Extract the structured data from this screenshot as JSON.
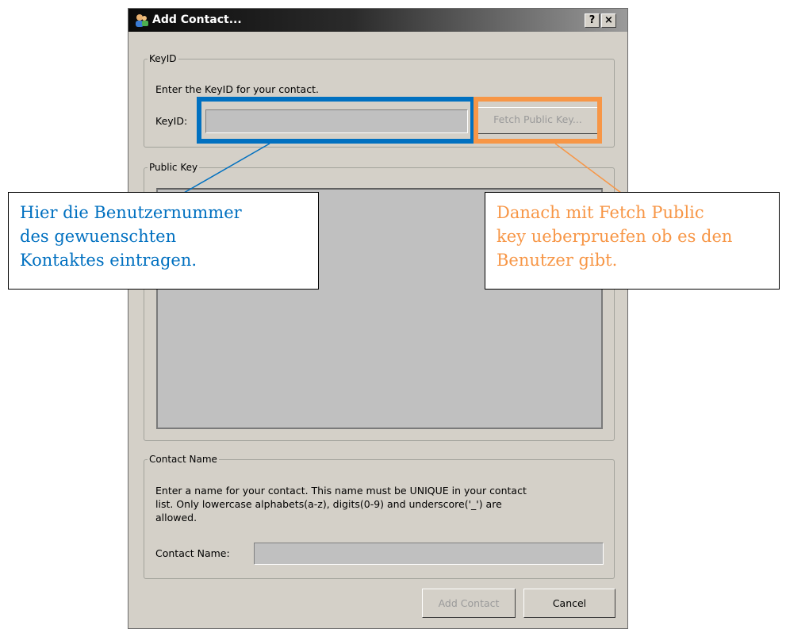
{
  "dialog": {
    "title": "Add Contact...",
    "help_button": "?",
    "close_button": "×"
  },
  "keyid_group": {
    "legend": "KeyID",
    "instruction": "Enter the KeyID for your contact.",
    "field_label": "KeyID:",
    "field_value": "",
    "fetch_button": "Fetch Public Key..."
  },
  "public_key_group": {
    "legend": "Public Key",
    "field_value": ""
  },
  "contact_name_group": {
    "legend": "Contact Name",
    "instruction_line1": "Enter a name for your contact. This name must be UNIQUE in your contact",
    "instruction_line2": "list. Only lowercase alphabets(a-z), digits(0-9) and underscore('_') are",
    "instruction_line3": "allowed.",
    "field_label": "Contact Name:",
    "field_value": ""
  },
  "buttons": {
    "add_contact": "Add Contact",
    "cancel": "Cancel"
  },
  "annotations": {
    "left_note": {
      "line1": "Hier die Benutzernummer",
      "line2": "des gewuenschten",
      "line3": "Kontaktes eintragen."
    },
    "right_note": {
      "line1": "Danach mit Fetch Public",
      "line2": "key ueberpruefen ob es den",
      "line3": "Benutzer gibt."
    },
    "colors": {
      "blue": "#0070c0",
      "orange": "#f79646"
    }
  }
}
